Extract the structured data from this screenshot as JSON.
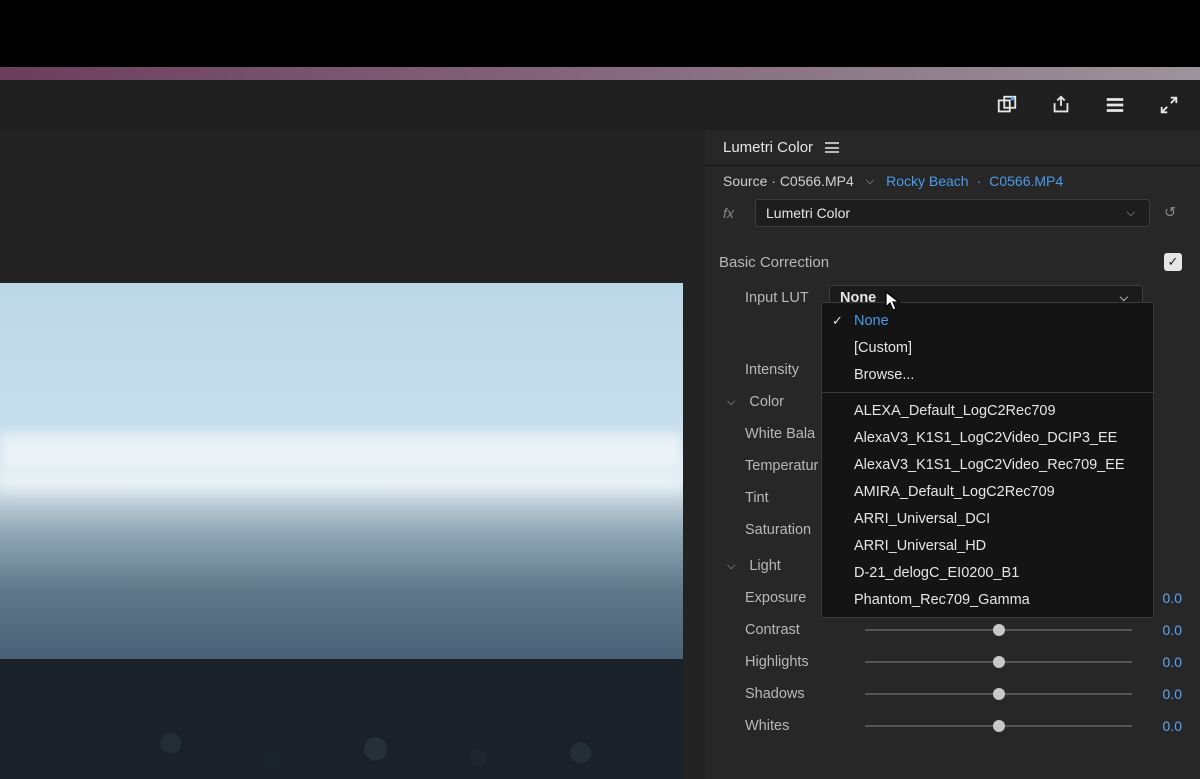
{
  "titlebar": {},
  "chrome_icons": {
    "workspaces": "workspace",
    "export": "export",
    "hamburger": "menu",
    "fullscreen": "fullscreen"
  },
  "panel": {
    "title": "Lumetri Color",
    "source_prefix": "Source ·",
    "source_clip": "C0566.MP4",
    "sequence": "Rocky Beach",
    "sequence_clip": "C0566.MP4",
    "effect_dropdown": "Lumetri Color"
  },
  "basic": {
    "section": "Basic Correction",
    "input_lut_label": "Input LUT",
    "input_lut_value": "None",
    "intensity": "Intensity",
    "color_group": "Color",
    "white_balance": "White Bala",
    "temperature": "Temperatur",
    "tint": "Tint",
    "saturation": "Saturation",
    "light_group": "Light",
    "exposure": "Exposure",
    "contrast": "Contrast",
    "highlights": "Highlights",
    "shadows": "Shadows",
    "whites": "Whites",
    "val_zero": "0.0"
  },
  "lut_menu": {
    "items": [
      "None",
      "[Custom]",
      "Browse...",
      "ALEXA_Default_LogC2Rec709",
      "AlexaV3_K1S1_LogC2Video_DCIP3_EE",
      "AlexaV3_K1S1_LogC2Video_Rec709_EE",
      "AMIRA_Default_LogC2Rec709",
      "ARRI_Universal_DCI",
      "ARRI_Universal_HD",
      "D-21_delogC_EI0200_B1",
      "Phantom_Rec709_Gamma"
    ]
  },
  "sliders": {
    "exposure": {
      "pos": 50
    },
    "contrast": {
      "pos": 50
    },
    "highlights": {
      "pos": 50
    },
    "shadows": {
      "pos": 50
    }
  }
}
